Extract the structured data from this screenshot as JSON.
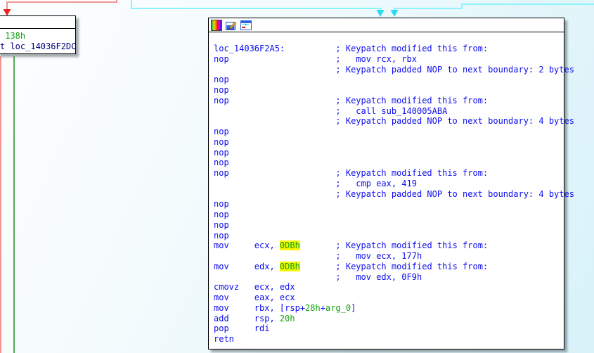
{
  "app": {
    "view_name": "IDA graph view node",
    "block_label": "loc_14036F2A5"
  },
  "colors": {
    "edge_red": "#f59494",
    "arrow_red": "#ee2222",
    "edge_cyan": "#8cf2fb",
    "arrow_cyan": "#28dbf0",
    "edge_green": "#57ab57",
    "code_blue": "#0d0df0",
    "code_green": "#12a012",
    "code_navy": "#00007a",
    "hl_yellow": "#f8f800"
  },
  "left_node": {
    "lines": [
      [
        [
          "g",
          " 138h"
        ]
      ],
      [
        [
          "n",
          "t loc_14036F2DC"
        ]
      ]
    ]
  },
  "main_node": {
    "toolbar_icons": [
      "node-color-icon",
      "edit-node-icon",
      "group-nodes-icon"
    ],
    "lines": [
      [
        [
          "b",
          "loc_14036F2A5:          "
        ],
        [
          "b",
          "; Keypatch modified this from:"
        ]
      ],
      [
        [
          "b",
          "nop                     "
        ],
        [
          "b",
          ";   mov rcx, rbx"
        ]
      ],
      [
        [
          "b",
          "                        "
        ],
        [
          "b",
          "; Keypatch padded NOP to next boundary: 2 bytes"
        ]
      ],
      [
        [
          "b",
          "nop"
        ]
      ],
      [
        [
          "b",
          "nop"
        ]
      ],
      [
        [
          "b",
          "nop                     "
        ],
        [
          "b",
          "; Keypatch modified this from:"
        ]
      ],
      [
        [
          "b",
          "                        "
        ],
        [
          "b",
          ";   call sub_140005ABA"
        ]
      ],
      [
        [
          "b",
          "                        "
        ],
        [
          "b",
          "; Keypatch padded NOP to next boundary: 4 bytes"
        ]
      ],
      [
        [
          "b",
          "nop"
        ]
      ],
      [
        [
          "b",
          "nop"
        ]
      ],
      [
        [
          "b",
          "nop"
        ]
      ],
      [
        [
          "b",
          "nop"
        ]
      ],
      [
        [
          "b",
          "nop                     "
        ],
        [
          "b",
          "; Keypatch modified this from:"
        ]
      ],
      [
        [
          "b",
          "                        "
        ],
        [
          "b",
          ";   cmp eax, 419"
        ]
      ],
      [
        [
          "b",
          "                        "
        ],
        [
          "b",
          "; Keypatch padded NOP to next boundary: 4 bytes"
        ]
      ],
      [
        [
          "b",
          "nop"
        ]
      ],
      [
        [
          "b",
          "nop"
        ]
      ],
      [
        [
          "b",
          "nop"
        ]
      ],
      [
        [
          "b",
          "nop"
        ]
      ],
      [
        [
          "b",
          "mov     ecx, "
        ],
        [
          "hl",
          "0DBh"
        ],
        [
          "b",
          "       "
        ],
        [
          "b",
          "; Keypatch modified this from:"
        ]
      ],
      [
        [
          "b",
          "                        "
        ],
        [
          "b",
          ";   mov ecx, 177h"
        ]
      ],
      [
        [
          "b",
          "mov     edx, "
        ],
        [
          "hl",
          "0DBh"
        ],
        [
          "b",
          "       "
        ],
        [
          "b",
          "; Keypatch modified this from:"
        ]
      ],
      [
        [
          "b",
          "                        "
        ],
        [
          "b",
          ";   mov edx, 0F9h"
        ]
      ],
      [
        [
          "b",
          "cmovz   ecx, edx"
        ]
      ],
      [
        [
          "b",
          "mov     eax, ecx"
        ]
      ],
      [
        [
          "b",
          "mov     rbx, [rsp+"
        ],
        [
          "g",
          "28h"
        ],
        [
          "b",
          "+"
        ],
        [
          "g",
          "arg_0"
        ],
        [
          "b",
          "]"
        ]
      ],
      [
        [
          "b",
          "add     rsp, "
        ],
        [
          "g",
          "20h"
        ]
      ],
      [
        [
          "b",
          "pop     rdi"
        ]
      ],
      [
        [
          "b",
          "retn"
        ]
      ]
    ]
  }
}
